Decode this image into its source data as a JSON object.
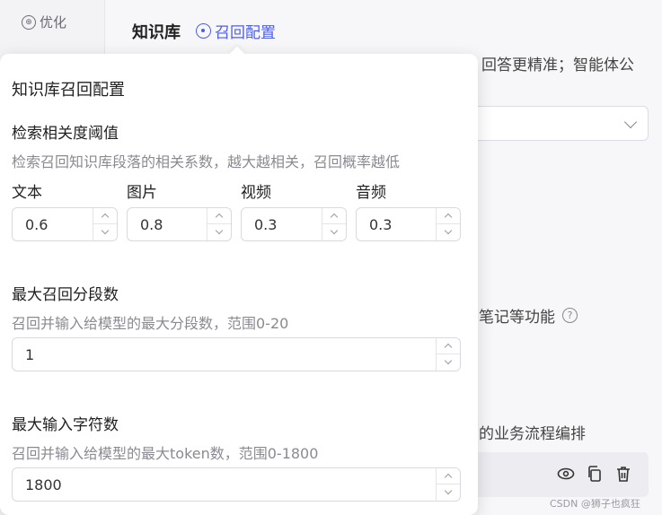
{
  "background": {
    "rail_item_label": "优化",
    "title": "知识库",
    "recall_link": "召回配置",
    "description_tail": "回答更精准；智能体公",
    "feature_text": "笔记等功能",
    "flow_text": "的业务流程编排",
    "watermark": "CSDN @狮子也疯狂"
  },
  "panel": {
    "title": "知识库召回配置",
    "relevance": {
      "title": "检索相关度阈值",
      "description": "检索召回知识库段落的相关系数，越大越相关，召回概率越低",
      "fields": [
        {
          "label": "文本",
          "value": "0.6"
        },
        {
          "label": "图片",
          "value": "0.8"
        },
        {
          "label": "视频",
          "value": "0.3"
        },
        {
          "label": "音频",
          "value": "0.3"
        }
      ]
    },
    "max_segments": {
      "title": "最大召回分段数",
      "description": "召回并输入给模型的最大分段数，范围0-20",
      "value": "1"
    },
    "max_chars": {
      "title": "最大输入字符数",
      "description": "召回并输入给模型的最大token数，范围0-1800",
      "value": "1800"
    }
  }
}
